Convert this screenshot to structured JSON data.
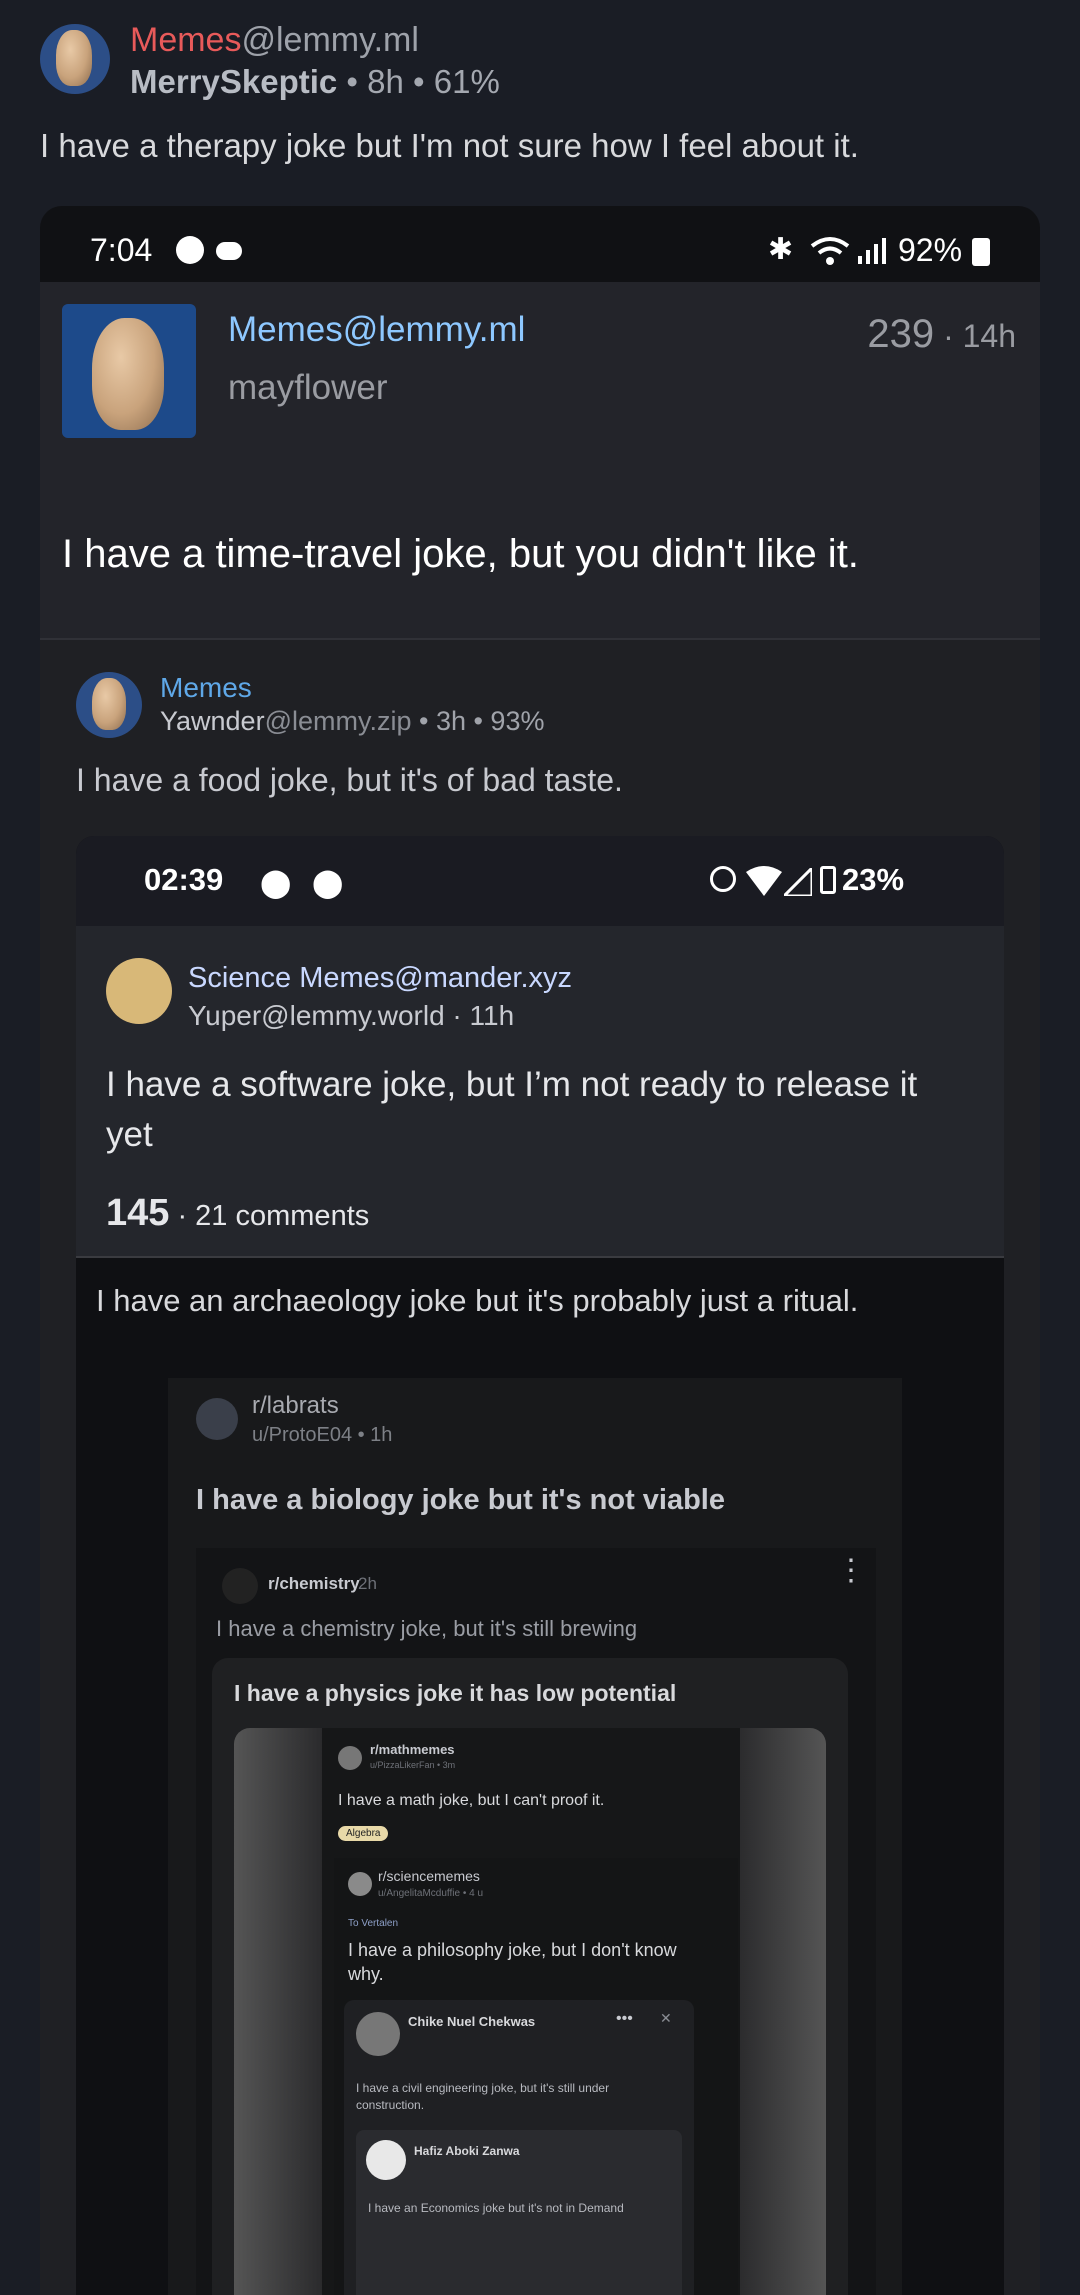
{
  "outer": {
    "community": "Memes",
    "instance": "@lemmy.ml",
    "author": "MerrySkeptic",
    "meta": " • 8h • 61%",
    "body": "I have a therapy joke but I'm not sure how I feel about it."
  },
  "shot1": {
    "status_time": "7:04",
    "battery": "92%",
    "community": "Memes@lemmy.ml",
    "author": "mayflower",
    "score": "239",
    "age": " · 14h",
    "title": "I have a time-travel joke, but you didn't like it."
  },
  "post2": {
    "community": "Memes",
    "author": "Yawnder",
    "instance": "@lemmy.zip",
    "meta": " • 3h • 93%",
    "body": "I have a food joke, but it's of bad taste."
  },
  "shot2": {
    "status_time": "02:39",
    "battery": "23%",
    "community": "Science Memes@mander.xyz",
    "author": "Yuper@lemmy.world · 11h",
    "title": "I have a software joke, but I’m not ready to release it yet",
    "score": "145",
    "comments": " · 21 comments",
    "reply": "I have an archaeology joke but it's probably just a ritual."
  },
  "shot3": {
    "subreddit": "r/labrats",
    "user": "u/ProtoE04 • 1h",
    "title": "I have a biology joke but it's not viable"
  },
  "shot4": {
    "subreddit": "r/chemistry",
    "age": "2h",
    "title": "I have a chemistry joke, but it's still brewing"
  },
  "shot5": {
    "title": "I have a physics joke it has low potential"
  },
  "shot6": {
    "subreddit": "r/mathmemes",
    "user": "u/PizzaLikerFan • 3m",
    "title": "I have a math joke, but I can't proof it.",
    "flair": "Algebra"
  },
  "shot7": {
    "subreddit": "r/sciencememes",
    "user": "u/AngelitaMcduffie • 4 u",
    "tag": "To Vertalen",
    "title": "I have a philosophy joke, but I don't know why."
  },
  "shot8": {
    "name": "Chike Nuel Chekwas",
    "body": "I have a civil engineering joke, but it's still under construction."
  },
  "shot9": {
    "name": "Hafiz Aboki Zanwa",
    "body": "I have an Economics joke but it's not in Demand"
  }
}
